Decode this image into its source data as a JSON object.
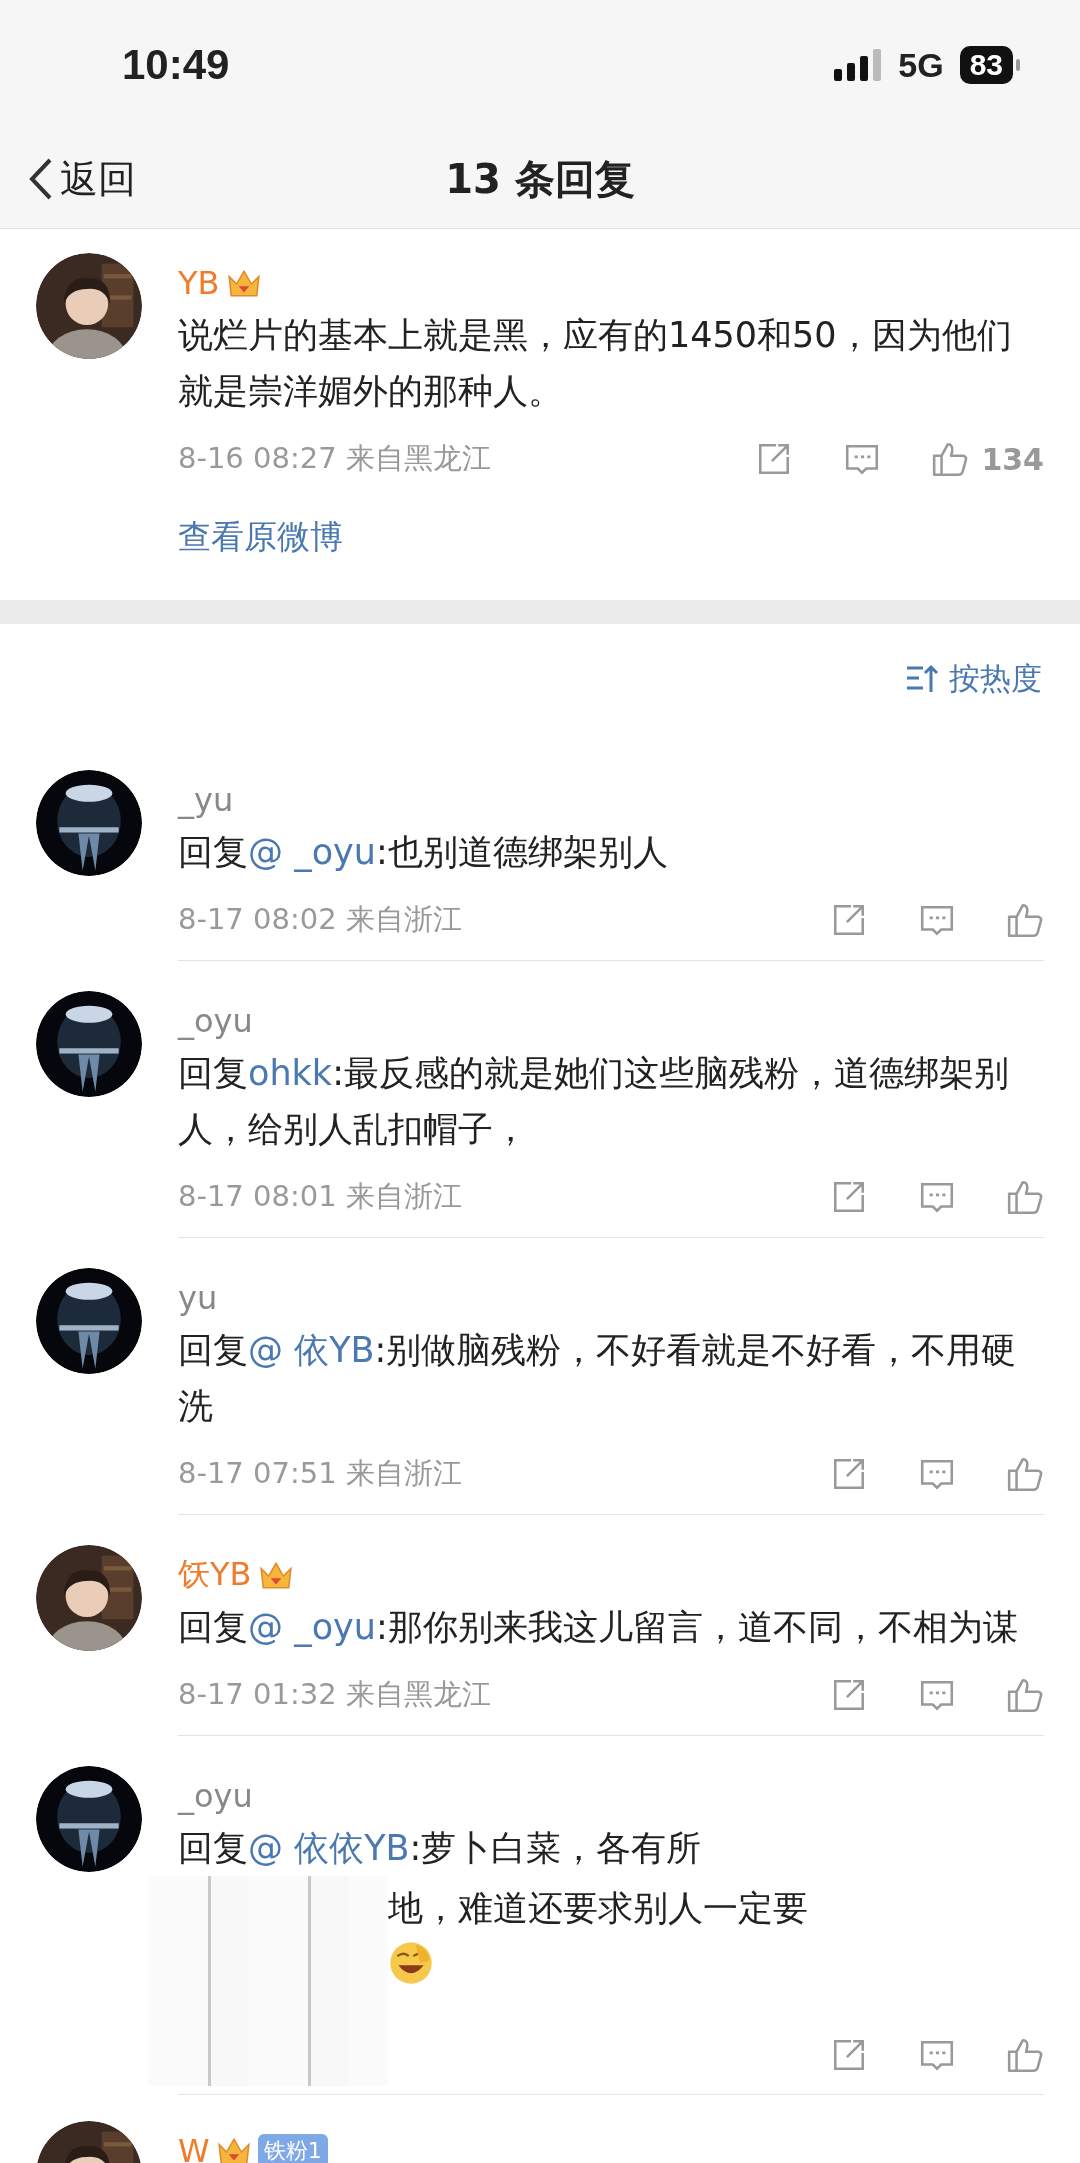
{
  "status_bar": {
    "time": "10:49",
    "network": "5G",
    "battery": "83"
  },
  "header": {
    "back": "返回",
    "title": "13 条回复"
  },
  "main_comment": {
    "name": "YB",
    "vip": true,
    "text": "说烂片的基本上就是黑，应有的1450和50，因为他们就是崇洋媚外的那种人。",
    "time": "8-16 08:27",
    "location": "来自黑龙江",
    "likes": "134",
    "link": "查看原微博"
  },
  "sort": {
    "label": "按热度"
  },
  "replies": [
    {
      "kind": "reply",
      "name": "_yu",
      "vip": false,
      "prefix": "回复",
      "mention": "@ _oyu",
      "body": ":也别道德绑架别人",
      "time": "8-17 08:02",
      "location": "来自浙江"
    },
    {
      "kind": "reply",
      "name": "_oyu",
      "vip": false,
      "prefix": "回复",
      "mention": "ohkk",
      "body": ":最反感的就是她们这些脑残粉，道德绑架别人，给别人乱扣帽子，",
      "time": "8-17 08:01",
      "location": "来自浙江"
    },
    {
      "kind": "reply",
      "name": "yu",
      "vip": false,
      "prefix": "回复",
      "mention": "@ 依YB",
      "body": ":别做脑残粉，不好看就是不好看，不用硬洗",
      "time": "8-17 07:51",
      "location": "来自浙江"
    },
    {
      "kind": "reply",
      "name": "饫YB",
      "vip": true,
      "prefix": "回复",
      "mention": "@ _oyu",
      "body": ":那你别来我这儿留言，道不同，不相为谋",
      "time": "8-17 01:32",
      "location": "来自黑龙江"
    },
    {
      "kind": "redacted",
      "name": "_oyu",
      "vip": false,
      "prefix": "回复",
      "mention": "@ 依依YB",
      "body": ":萝卜白菜，各有所",
      "continuation": "地，难道还要求别人一定要"
    },
    {
      "kind": "partial",
      "name": "W",
      "vip": true,
      "badge": "铁粉1"
    }
  ]
}
